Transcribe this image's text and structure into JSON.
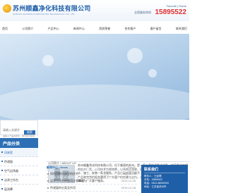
{
  "header": {
    "company_cn": "苏州顺鑫净化科技有限公司",
    "company_en": "SUZHOU SHUNXIN PURIFICATION TECHNOLOGY CO.,LTD",
    "top_links": "Favorite  |  Home",
    "hotline_label": "全国服务热线",
    "hotline": "15895522"
  },
  "nav": [
    "首页",
    "公司简介",
    "产品中心",
    "新闻中心",
    "资质荣誉",
    "合作客户",
    "客户留言",
    "联系我们"
  ],
  "search": {
    "placeholder": "请输入关键字",
    "value": "请输入产品关键字，我们会为您查询",
    "button": "搜索"
  },
  "categories": {
    "title": "产品分类",
    "title_en": "PRODUCTS",
    "items": [
      "风淋室",
      "传递窗",
      "空气自净器",
      "洁净工作台",
      "层流罩",
      "超净化设备"
    ]
  },
  "about": {
    "heading": "公司简介 / ABOUT US",
    "text": "苏州顺鑫净化科技有限公司，位于美丽的苏州，是一家从事空调净化设备、空气净化工程的生产厂家。公司技术力量雄厚，以高效过滤器、风淋室、传递窗等净化产品为主导，设计、施工、安装一条龙服务。产品广泛应用于电子、医药、食品、化工等领域，以优质的产品和完善的服务赢得了广大客户的信赖与支持。公司本着质量第一、用户至上的宗旨，竭诚为广大客户服务。",
    "more": "[详细]"
  },
  "news": {
    "title": "新闻中心 / News",
    "more": "more+",
    "items": [
      {
        "title": "如何判断风淋室的优劣",
        "date": "2019-12-28"
      },
      {
        "title": "洁净工作台的使用注意事项",
        "date": "2019-12-28"
      },
      {
        "title": "传递窗的分类及作用",
        "date": "2019-12-28"
      }
    ]
  },
  "contact": {
    "title": "联系我们",
    "lines": [
      "联系人：王经理",
      "手机：15895522",
      "电话：0512-68000000",
      "地址：江苏省苏州市"
    ]
  },
  "colors": {
    "brand_blue": "#1f5fa8",
    "accent_blue": "#2c6fb4",
    "hotline_red": "#e03030"
  }
}
